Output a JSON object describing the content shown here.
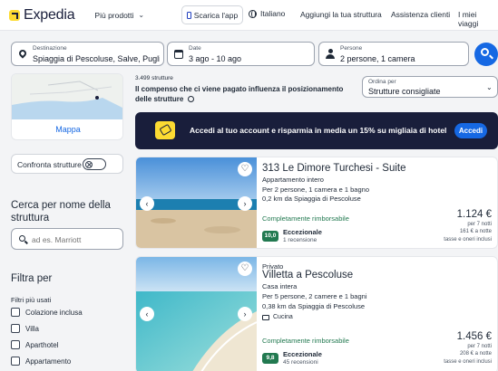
{
  "header": {
    "logo": "Expedia",
    "more_products": "Più prodotti",
    "app_download": "Scarica l'app",
    "language": "Italiano",
    "list_property": "Aggiungi la tua struttura",
    "support": "Assistenza clienti",
    "trips": "I miei viaggi"
  },
  "search": {
    "destination_label": "Destinazione",
    "destination_value": "Spiaggia di Pescoluse, Salve, Pugli...",
    "date_label": "Date",
    "date_value": "3 ago - 10 ago",
    "travelers_label": "Persone",
    "travelers_value": "2 persone, 1 camera"
  },
  "sidebar": {
    "map_label": "Mappa",
    "compare_label": "Confronta strutture",
    "search_name_title": "Cerca per nome della struttura",
    "search_name_placeholder": "ad es. Marriott",
    "filter_title": "Filtra per",
    "popular_filters_title": "Filtri più usati",
    "filters": [
      "Colazione inclusa",
      "Villa",
      "Aparthotel",
      "Appartamento"
    ]
  },
  "results": {
    "count": "3.499 strutture",
    "disclaimer": "Il compenso che ci viene pagato influenza il posizionamento delle strutture",
    "sort_label": "Ordina per",
    "sort_value": "Strutture consigliate"
  },
  "promo": {
    "text": "Accedi al tuo account e risparmia in media un 15% su migliaia di hotel",
    "button": "Accedi"
  },
  "hotels": [
    {
      "tag": "",
      "name": "313 Le Dimore Turchesi - Suite",
      "type": "Appartamento intero",
      "capacity": "Per 2 persone, 1 camera e 1 bagno",
      "distance": "0,2 km da Spiaggia di Pescoluse",
      "amenity": "",
      "refund": "Completamente rimborsabile",
      "score": "10,0",
      "score_label": "Eccezionale",
      "reviews": "1 recensione",
      "price": "1.124 €",
      "nights": "per 7 notti",
      "per_night": "161 € a notte",
      "taxes": "tasse e oneri inclusi"
    },
    {
      "tag": "Privato",
      "name": "Villetta a Pescoluse",
      "type": "Casa intera",
      "capacity": "Per 5 persone, 2 camere e 1 bagni",
      "distance": "0,38 km da Spiaggia di Pescoluse",
      "amenity": "Cucina",
      "refund": "Completamente rimborsabile",
      "score": "9,8",
      "score_label": "Eccezionale",
      "reviews": "45 recensioni",
      "price": "1.456 €",
      "nights": "per 7 notti",
      "per_night": "208 € a notte",
      "taxes": "tasse e oneri inclusi"
    }
  ],
  "icons": [
    "phone-icon",
    "globe-icon",
    "pin-icon",
    "calendar-icon",
    "user-icon",
    "search-icon",
    "info-icon",
    "heart-icon",
    "kitchen-icon",
    "chevron-down-icon"
  ],
  "colors": {
    "brand_yellow": "#fddb32",
    "brand_navy": "#191e3b",
    "primary_blue": "#1668e3",
    "refund_green": "#227950"
  }
}
